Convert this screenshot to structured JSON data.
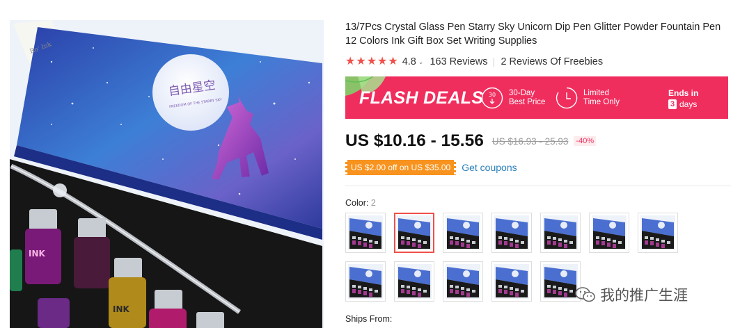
{
  "product": {
    "title": "13/7Pcs Crystal Glass Pen Starry Sky Unicorn Dip Pen Glitter Powder Fountain Pen 12 Colors Ink Gift Box Set Writing Supplies",
    "image_box_text": "自由星空",
    "image_box_subtext": "FREEDOM OF THE STARRY SKY",
    "image_ink_label": "INK",
    "image_corner_text": "Ro' Ink"
  },
  "rating": {
    "stars": 5,
    "score": "4.8",
    "reviews": "163 Reviews",
    "freebies": "2 Reviews Of Freebies"
  },
  "flash": {
    "title": "FLASH DEALS",
    "feature1_icon_num": "30",
    "feature1_line1": "30-Day",
    "feature1_line2": "Best Price",
    "feature2_line1": "Limited",
    "feature2_line2": "Time Only",
    "ends_label": "Ends in",
    "days_num": "3",
    "days_label": "days"
  },
  "price": {
    "current": "US $10.16 - 15.56",
    "original": "US $16.93 - 25.93",
    "discount": "-40%"
  },
  "coupon": {
    "label": "US $2.00 off on US $35.00",
    "link": "Get coupons"
  },
  "color": {
    "label": "Color:",
    "count": "2",
    "selected_index": 1,
    "total": 12
  },
  "ships": {
    "label": "Ships From:"
  },
  "watermark": {
    "text": "我的推广生涯"
  },
  "colors": {
    "accent": "#f02e5e",
    "star": "#f0504a",
    "coupon": "#f7931e",
    "link": "#2a7fb8"
  }
}
